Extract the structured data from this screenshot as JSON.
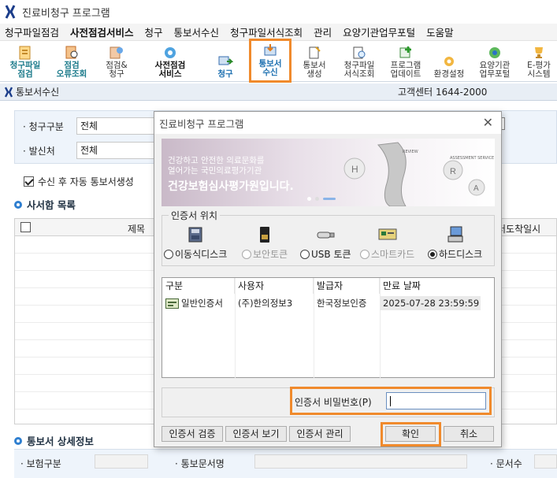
{
  "app": {
    "title": "진료비청구 프로그램"
  },
  "menu": [
    {
      "label": "청구파일점검",
      "bold": false
    },
    {
      "label": "사전점검서비스",
      "bold": true
    },
    {
      "label": "청구",
      "bold": false
    },
    {
      "label": "통보서수신",
      "bold": false
    },
    {
      "label": "청구파일서식조회",
      "bold": false
    },
    {
      "label": "관리",
      "bold": false
    },
    {
      "label": "요양기관업무포털",
      "bold": false
    },
    {
      "label": "도움말",
      "bold": false
    }
  ],
  "toolbar": {
    "items": [
      {
        "label": "청구파일\n점검",
        "icon": "file-check-icon"
      },
      {
        "label": "점검\n오류조회",
        "icon": "error-search-icon"
      },
      {
        "label": "점검&\n청구",
        "icon": "check-claim-icon"
      },
      {
        "label": "사전점검\n서비스",
        "icon": "precheck-icon"
      },
      {
        "label": "청구",
        "icon": "claim-icon"
      },
      {
        "label": "통보서\n수신",
        "icon": "receive-notice-icon"
      },
      {
        "label": "통보서\n생성",
        "icon": "create-notice-icon"
      },
      {
        "label": "청구파일\n서식조회",
        "icon": "form-search-icon"
      },
      {
        "label": "프로그램\n업데이트",
        "icon": "update-icon"
      },
      {
        "label": "환경설정",
        "icon": "settings-icon"
      },
      {
        "label": "요양기관\n업무포털",
        "icon": "portal-icon"
      },
      {
        "label": "E-평가\n시스템",
        "icon": "trophy-icon"
      }
    ],
    "active": "통보서 수신"
  },
  "section": {
    "title": "통보서수신",
    "support": "고객센터 1644-2000"
  },
  "filter": {
    "claim_type_label": "청구구분",
    "claim_type_value": "전체",
    "sender_label": "발신처",
    "sender_value": "전체"
  },
  "auto_create": {
    "label": "수신 후 자동 통보서생성",
    "checked": true
  },
  "mailbox": {
    "title": "사서함 목록",
    "col_title": "제목",
    "col_right": "터도착일시"
  },
  "detail": {
    "title": "통보서 상세정보",
    "insurance_label": "보험구분",
    "doc_name_label": "통보문서명",
    "doc_count_label": "문서수"
  },
  "dialog": {
    "title": "진료비청구 프로그램",
    "banner": {
      "line1": "건강하고 안전한 의료문화를\n열어가는 국민의료평가기관",
      "line2": "건강보험심사평가원입니다.",
      "tag1": "REVIEW",
      "tag2": "ASSESSMENT\nSERVICE"
    },
    "location_label": "인증서 위치",
    "locations": [
      {
        "label": "이동식디스크",
        "icon": "usb-disk-icon",
        "selected": false,
        "enabled": true
      },
      {
        "label": "보안토큰",
        "icon": "security-token-icon",
        "selected": false,
        "enabled": false
      },
      {
        "label": "USB 토큰",
        "icon": "usb-token-icon",
        "selected": false,
        "enabled": true
      },
      {
        "label": "스마트카드",
        "icon": "smartcard-icon",
        "selected": false,
        "enabled": false
      },
      {
        "label": "하드디스크",
        "icon": "hard-disk-icon",
        "selected": true,
        "enabled": true
      }
    ],
    "cert_table": {
      "headers": [
        "구분",
        "사용자",
        "발급자",
        "만료 날짜"
      ],
      "rows": [
        [
          "일반인증서",
          "(주)한의정보3",
          "한국정보인증",
          "2025-07-28 23:59:59"
        ]
      ]
    },
    "password_label": "인증서 비밀번호(P)",
    "buttons": {
      "verify": "인증서 검증",
      "view": "인증서 보기",
      "manage": "인증서 관리",
      "ok": "확인",
      "cancel": "취소"
    }
  }
}
